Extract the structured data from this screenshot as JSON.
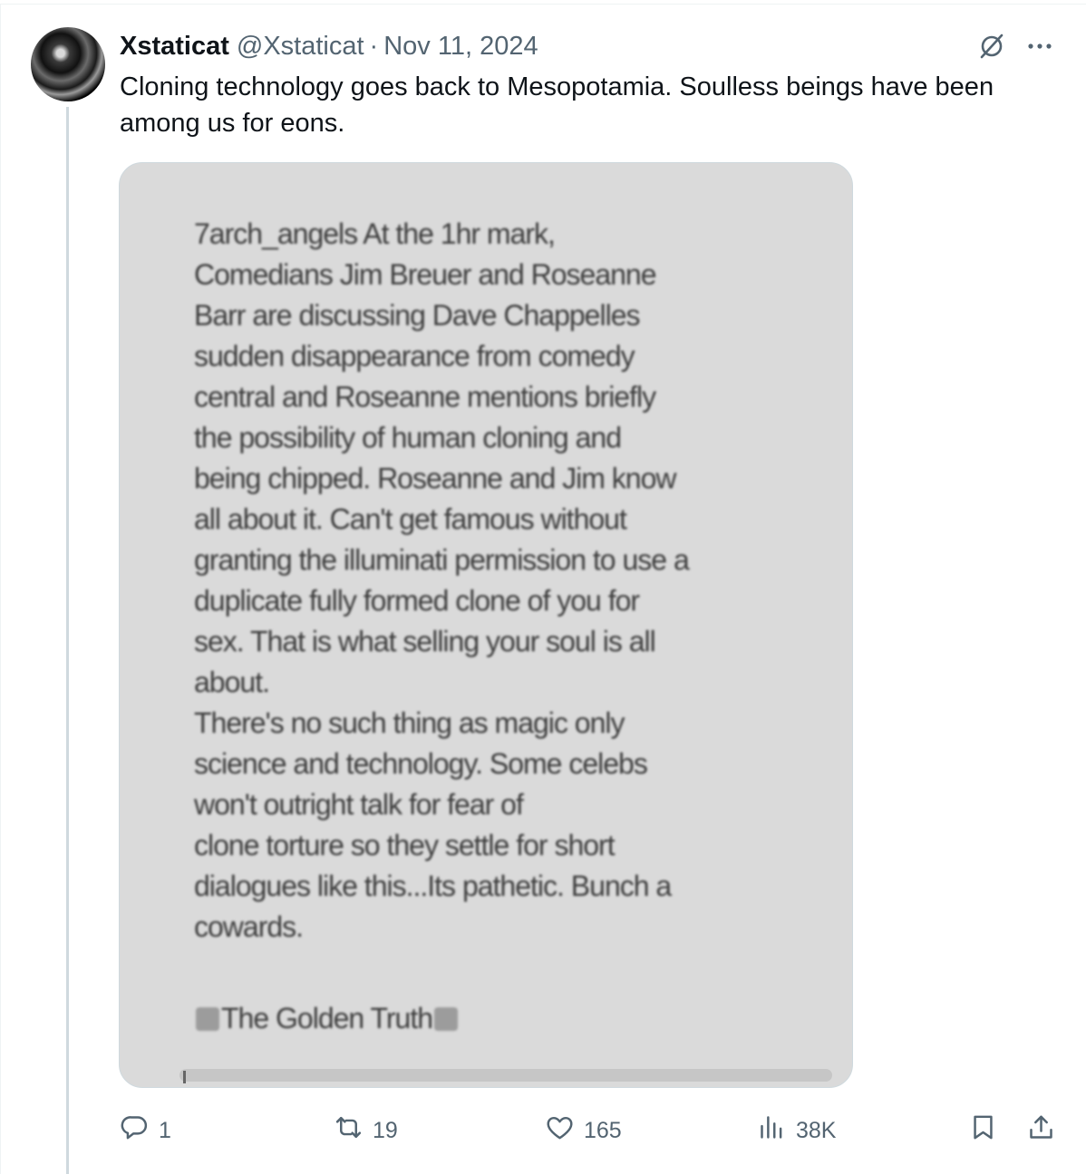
{
  "tweet": {
    "display_name": "Xstaticat",
    "handle": "@Xstaticat",
    "separator": "·",
    "date": "Nov 11, 2024",
    "text": "Cloning technology goes back to Mesopotamia. Soulless beings have been among us for eons.",
    "icons": {
      "grok": "grok-icon",
      "more": "more-icon"
    }
  },
  "media": {
    "body": "7arch_angels At the 1hr mark,\nComedians Jim Breuer and Roseanne\nBarr are discussing Dave Chappelles\nsudden disappearance from comedy\ncentral and Roseanne mentions briefly\nthe possibility of human cloning and\nbeing chipped. Roseanne and Jim know\nall about it. Can't get famous without\ngranting the illuminati permission to use a\nduplicate fully formed clone of you for\nsex. That is what selling your soul is all\nabout.\nThere's no such thing as magic only\nscience and technology. Some celebs\nwon't outright talk for fear of\nclone torture so they settle for short\ndialogues like this...Its pathetic. Bunch a\ncowards.",
    "signature": "The Golden Truth"
  },
  "actions": {
    "replies": "1",
    "reposts": "19",
    "likes": "165",
    "views": "38K",
    "icons": [
      "reply-icon",
      "repost-icon",
      "like-icon",
      "views-icon",
      "bookmark-icon",
      "share-icon"
    ]
  },
  "colors": {
    "text": "#0f1419",
    "secondary": "#536471",
    "thread_line": "#cfd9de"
  }
}
